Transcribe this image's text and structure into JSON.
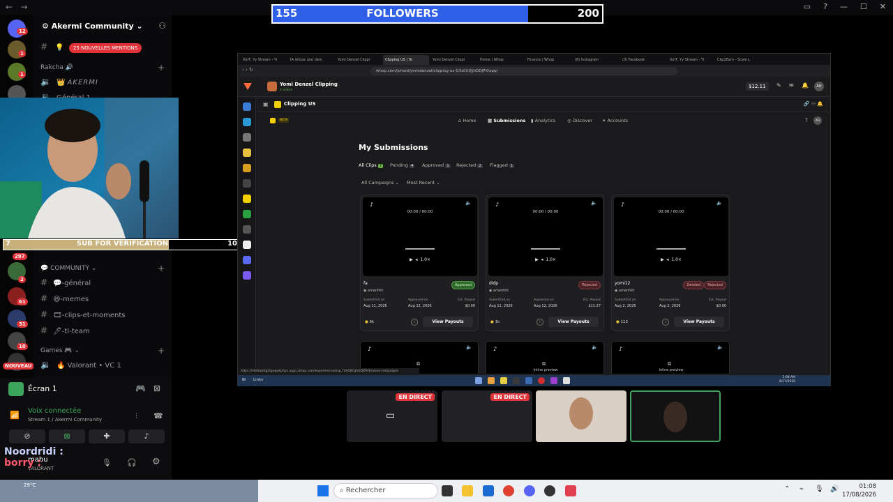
{
  "followers": {
    "current": "155",
    "label": "FOLLOWERS",
    "goal": "200",
    "progress": 0.775
  },
  "discord": {
    "server_name": "Akermi Community",
    "mentions": "25 NOUVELLES MENTIONS",
    "category_rakcha": "Rakcha",
    "akermi_channel": "AKERMI",
    "general_voice": "Général 1",
    "category_community": "COMMUNITY",
    "channels": [
      "-général",
      "-memes",
      "-clips-et-moments",
      "-tl-team"
    ],
    "category_games": "Games",
    "valorant_channel": "Valorant • VC 1",
    "server_badges": [
      "12",
      "1",
      "1",
      "297",
      "2",
      "61",
      "31",
      "10"
    ],
    "nouveau": "NOUVEAU"
  },
  "sub_bar": {
    "left": "7",
    "label": "SUB FOR VERIFICATION",
    "goal": "10",
    "progress": 0.7
  },
  "voice": {
    "screen_label": "Écran 1",
    "status": "Voix connectée",
    "stream_info": "Stream 1 / Akermi Community",
    "username": "mabu",
    "user_status": "VALORANT"
  },
  "chat": [
    {
      "user": "Noordridi :"
    },
    {
      "user": "borry :"
    }
  ],
  "weather": "29°C",
  "browser": {
    "tabs": [
      "XoiT, Yy Stream - Yi",
      "IA refuse une dem",
      "Yomi Denzel Clippi",
      "Clipping US | Yo",
      "Yomi Denzel Clippi",
      "Home | Whop",
      "Finance | Whop",
      "(8) Instagram",
      "(3) Facebook",
      "XoiT, Yy Stream - Yi",
      "Clip2Earn - Scale L"
    ],
    "active_tab_index": 3,
    "url": "whop.com/joined/yomidenzel/clipping-us-G3s0XQjjhDDJPX/app/",
    "account_name": "Yomi Denzel Clipping",
    "account_sub": "2 online",
    "balance": "$12.11",
    "avatar_initials": "AH",
    "app_title": "Clipping US",
    "beta": "BETA",
    "nav": [
      "Home",
      "Submissions",
      "Analytics",
      "Discover",
      "Accounts"
    ],
    "nav_active": "Submissions",
    "page_title": "My Submissions",
    "filters": [
      {
        "label": "All Clips",
        "count": "7",
        "active": true
      },
      {
        "label": "Pending",
        "count": "4",
        "active": false
      },
      {
        "label": "Approved",
        "count": "1",
        "active": false
      },
      {
        "label": "Rejected",
        "count": "2",
        "active": false
      },
      {
        "label": "Flagged",
        "count": "1",
        "active": false
      }
    ],
    "sort_campaigns": "All Campaigns",
    "sort_order": "Most Recent",
    "cards": [
      {
        "name": "fa",
        "user": "amenhkt",
        "status": [
          "Approved"
        ],
        "submitted": "Aug 11, 2026",
        "approved": "Aug 12, 2026",
        "payout": "$0.00",
        "views": "6k",
        "time": "00:00 / 00:00",
        "speed": "1.0×"
      },
      {
        "name": "didp",
        "user": "amenhkt",
        "status": [
          "Rejected"
        ],
        "submitted": "Aug 11, 2026",
        "approved": "Aug 12, 2026",
        "payout": "$11.27",
        "views": "1k",
        "time": "00:00 / 00:00",
        "speed": "1.0×"
      },
      {
        "name": "yomi12",
        "user": "amenhkt",
        "status": [
          "Deleted",
          "Rejected"
        ],
        "submitted": "Aug 2, 2026",
        "approved": "Aug 2, 2026",
        "payout": "$0.00",
        "views": "113",
        "time": "00:00 / 00:00",
        "speed": "1.0×"
      }
    ],
    "labels": {
      "submitted_on": "Submitted on",
      "approved_on": "Approved on",
      "est_payout": "Est. Payout",
      "view_payouts": "View Payouts",
      "inline_preview": "Inline preview"
    },
    "status_url": "https://xfe0wbfqp0gogq4pfqrs.apps.whop.com/experiences/exp_f2hD8CjjhDDJPX/browse-campaigns",
    "taskbar_time": "1:08 AM",
    "taskbar_date": "8/17/2026",
    "links": "Links"
  },
  "streams": [
    {
      "live": "EN DIRECT"
    },
    {
      "live": "EN DIRECT"
    }
  ],
  "taskbar": {
    "search": "Rechercher",
    "time": "01:08",
    "date": "17/08/2026"
  }
}
